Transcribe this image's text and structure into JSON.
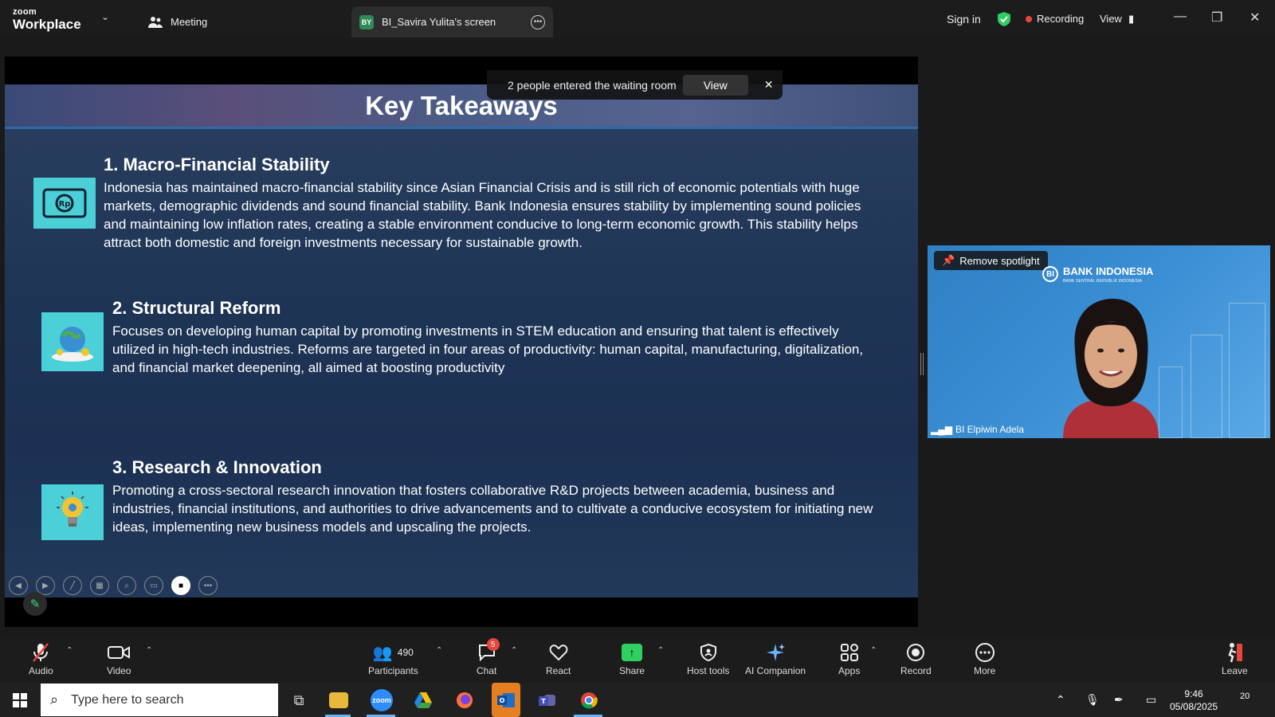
{
  "titlebar": {
    "logo_small": "zoom",
    "logo_big": "Workplace",
    "tab_meeting": "Meeting",
    "tab_screen_initials": "BY",
    "tab_screen": "BI_Savira Yulita's screen",
    "sign_in": "Sign in",
    "recording": "Recording",
    "view": "View"
  },
  "waiting_toast": {
    "text": "2 people entered the waiting room",
    "view_label": "View",
    "close": "✕"
  },
  "slide": {
    "title": "Key Takeaways",
    "sections": [
      {
        "heading": "1. Macro-Financial Stability",
        "body": "Indonesia has maintained macro-financial stability since Asian Financial Crisis and is still rich of economic potentials with huge markets, demographic dividends and sound financial stability. Bank Indonesia ensures stability by implementing sound policies and maintaining low inflation rates, creating a stable environment conducive to long-term economic growth. This stability helps attract both domestic and foreign investments necessary for sustainable growth.",
        "icon": "money-icon"
      },
      {
        "heading": "2. Structural Reform",
        "body": "Focuses on developing human capital by promoting investments in STEM education and ensuring that talent is effectively utilized in high-tech industries. Reforms are targeted in four areas of productivity: human capital, manufacturing, digitalization, and financial market deepening, all aimed at boosting productivity",
        "icon": "globe-icon"
      },
      {
        "heading": "3. Research & Innovation",
        "body": "Promoting a cross-sectoral research innovation that fosters collaborative R&D projects between academia, business and industries, financial institutions, and authorities to drive advancements and to cultivate a conducive ecosystem for initiating new ideas, implementing new business models and upscaling the projects.",
        "icon": "lightbulb-icon"
      }
    ]
  },
  "video": {
    "spotlight_label": "Remove spotlight",
    "logo_name": "BANK INDONESIA",
    "logo_sub": "BANK SENTRAL REPUBLIK INDONESIA",
    "participant_name": "BI Elpiwin Adela"
  },
  "toolbar": {
    "audio": "Audio",
    "video": "Video",
    "participants": "Participants",
    "participants_count": "490",
    "chat": "Chat",
    "chat_badge": "5",
    "react": "React",
    "share": "Share",
    "host_tools": "Host tools",
    "ai_companion": "AI Companion",
    "apps": "Apps",
    "record": "Record",
    "more": "More",
    "leave": "Leave"
  },
  "taskbar": {
    "search_placeholder": "Type here to search",
    "time": "9:46",
    "date": "05/08/2025",
    "notifications": "20"
  },
  "colors": {
    "accent_green": "#2fcf62",
    "recording_red": "#e8453c",
    "slide_icon_bg": "#4ad0d6"
  }
}
